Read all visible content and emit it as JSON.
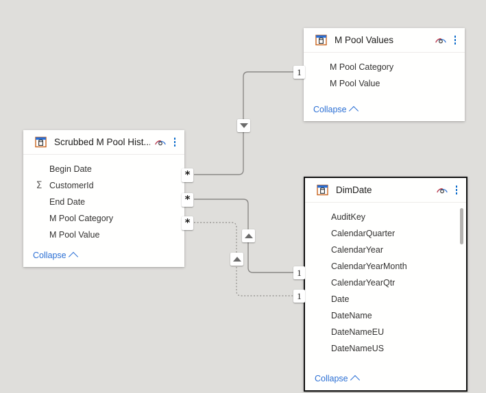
{
  "canvas": {
    "background": "#dfdedb",
    "app": "Power BI Model View"
  },
  "tables": [
    {
      "id": "m-pool-values",
      "title": "M Pool Values",
      "selected": false,
      "collapse_label": "Collapse",
      "fields": [
        {
          "name": "M Pool Category",
          "measure": false
        },
        {
          "name": "M Pool Value",
          "measure": false
        }
      ]
    },
    {
      "id": "scrubbed-m-pool-hist",
      "title": "Scrubbed M Pool Hist...",
      "selected": false,
      "collapse_label": "Collapse",
      "fields": [
        {
          "name": "Begin Date",
          "measure": false
        },
        {
          "name": "CustomerId",
          "measure": true
        },
        {
          "name": "End Date",
          "measure": false
        },
        {
          "name": "M Pool Category",
          "measure": false
        },
        {
          "name": "M Pool Value",
          "measure": false
        }
      ]
    },
    {
      "id": "dim-date",
      "title": "DimDate",
      "selected": true,
      "collapse_label": "Collapse",
      "fields": [
        {
          "name": "AuditKey",
          "measure": false
        },
        {
          "name": "CalendarQuarter",
          "measure": false
        },
        {
          "name": "CalendarYear",
          "measure": false
        },
        {
          "name": "CalendarYearMonth",
          "measure": false
        },
        {
          "name": "CalendarYearQtr",
          "measure": false
        },
        {
          "name": "Date",
          "measure": false
        },
        {
          "name": "DateName",
          "measure": false
        },
        {
          "name": "DateNameEU",
          "measure": false
        },
        {
          "name": "DateNameUS",
          "measure": false
        }
      ]
    }
  ],
  "relationships": [
    {
      "id": "rel-1",
      "from_table": "scrubbed-m-pool-hist",
      "to_table": "m-pool-values",
      "from_cardinality": "*",
      "to_cardinality": "1",
      "active": true,
      "cross_filter_direction": "down"
    },
    {
      "id": "rel-2",
      "from_table": "scrubbed-m-pool-hist",
      "to_table": "dim-date",
      "from_cardinality": "*",
      "to_cardinality": "1",
      "active": true,
      "cross_filter_direction": "up"
    },
    {
      "id": "rel-3",
      "from_table": "scrubbed-m-pool-hist",
      "to_table": "dim-date",
      "from_cardinality": "*",
      "to_cardinality": "1",
      "active": false,
      "cross_filter_direction": "up"
    }
  ],
  "icons": {
    "table": "table-icon",
    "eye": "hidden-eye-icon",
    "kebab": "more-options-icon",
    "sigma": "measure-sigma-icon",
    "chevron_up": "chevron-up-icon"
  },
  "colors": {
    "background": "#dfdedb",
    "card": "#fffffe",
    "link": "#2b6fd4",
    "line": "#8a8886",
    "selected_border": "#111111",
    "kebab_dot": "#0b6bcb"
  }
}
